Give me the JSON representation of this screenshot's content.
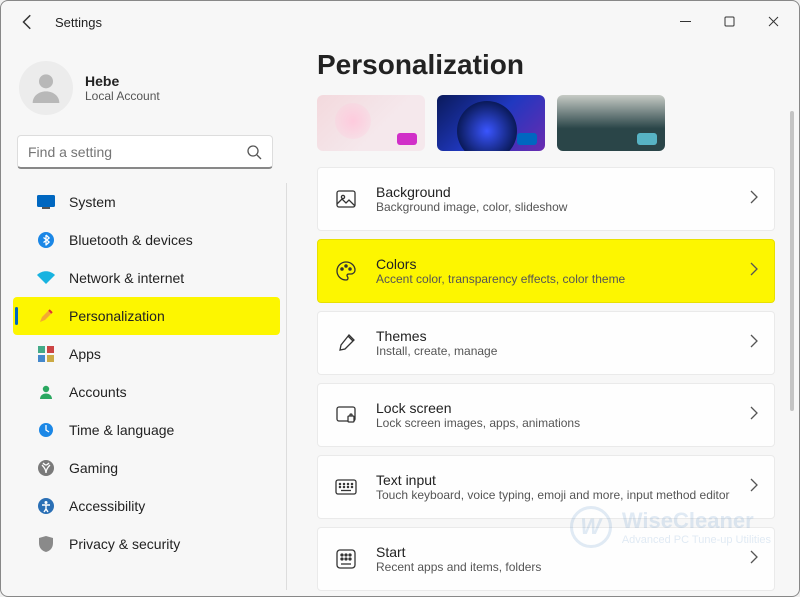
{
  "app_name": "Settings",
  "user": {
    "name": "Hebe",
    "account": "Local Account"
  },
  "search": {
    "placeholder": "Find a setting"
  },
  "nav": [
    {
      "label": "System",
      "active": false
    },
    {
      "label": "Bluetooth & devices",
      "active": false
    },
    {
      "label": "Network & internet",
      "active": false
    },
    {
      "label": "Personalization",
      "active": true
    },
    {
      "label": "Apps",
      "active": false
    },
    {
      "label": "Accounts",
      "active": false
    },
    {
      "label": "Time & language",
      "active": false
    },
    {
      "label": "Gaming",
      "active": false
    },
    {
      "label": "Accessibility",
      "active": false
    },
    {
      "label": "Privacy & security",
      "active": false
    }
  ],
  "page_title": "Personalization",
  "cards": [
    {
      "title": "Background",
      "subtitle": "Background image, color, slideshow",
      "highlight": false
    },
    {
      "title": "Colors",
      "subtitle": "Accent color, transparency effects, color theme",
      "highlight": true
    },
    {
      "title": "Themes",
      "subtitle": "Install, create, manage",
      "highlight": false
    },
    {
      "title": "Lock screen",
      "subtitle": "Lock screen images, apps, animations",
      "highlight": false
    },
    {
      "title": "Text input",
      "subtitle": "Touch keyboard, voice typing, emoji and more, input method editor",
      "highlight": false
    },
    {
      "title": "Start",
      "subtitle": "Recent apps and items, folders",
      "highlight": false
    }
  ],
  "watermark": {
    "title": "WiseCleaner",
    "subtitle": "Advanced PC Tune-up Utilities",
    "logo_letter": "W"
  }
}
